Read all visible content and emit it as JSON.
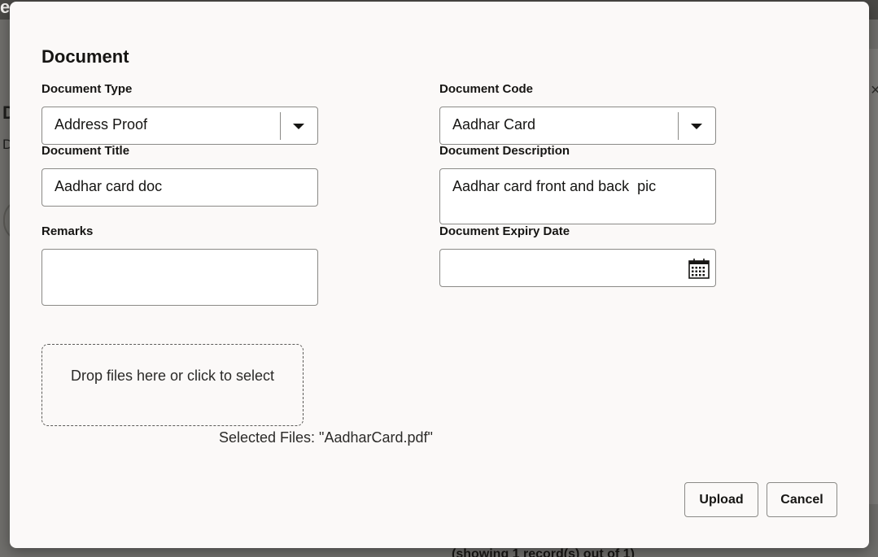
{
  "background": {
    "fragment_top": "e",
    "fragment_left": "D",
    "fragment_left_small": "D",
    "bottom_text": "(showing 1 record(s) out of 1)",
    "close_glyph": "×"
  },
  "dialog": {
    "title": "Document",
    "document_type": {
      "label": "Document Type",
      "value": "Address Proof"
    },
    "document_code": {
      "label": "Document Code",
      "value": "Aadhar Card"
    },
    "document_title": {
      "label": "Document Title",
      "value": "Aadhar card doc"
    },
    "document_description": {
      "label": "Document Description",
      "value": "Aadhar card front and back  pic"
    },
    "remarks": {
      "label": "Remarks",
      "value": ""
    },
    "document_expiry_date": {
      "label": "Document Expiry Date",
      "value": ""
    },
    "dropzone_text": "Drop files here or click to select",
    "selected_files": "Selected Files: \"AadharCard.pdf\"",
    "buttons": {
      "upload": "Upload",
      "cancel": "Cancel"
    }
  },
  "icons": {
    "dropdown": "caret-down-icon",
    "calendar": "calendar-icon"
  }
}
